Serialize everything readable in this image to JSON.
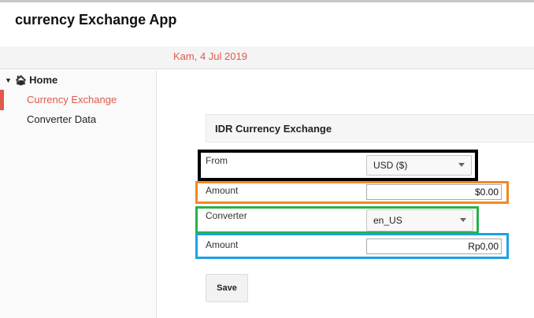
{
  "app": {
    "title": "currency Exchange App"
  },
  "subheader": {
    "date": "Kam, 4 Jul 2019"
  },
  "sidebar": {
    "home_label": "Home",
    "items": [
      {
        "label": "Currency Exchange",
        "active": true
      },
      {
        "label": "Converter Data",
        "active": false
      }
    ]
  },
  "panel": {
    "title": "IDR Currency Exchange"
  },
  "form": {
    "from_label": "From",
    "from_value": "USD ($)",
    "amount1_label": "Amount",
    "amount1_value": "$0.00",
    "converter_label": "Converter",
    "converter_value": "en_US",
    "amount2_label": "Amount",
    "amount2_value": "Rp0,00",
    "save_label": "Save"
  },
  "colors": {
    "accent": "#e05a4a",
    "box_from": "#000000",
    "box_amount1": "#f08a24",
    "box_converter": "#27b24a",
    "box_amount2": "#1ea0e6"
  }
}
